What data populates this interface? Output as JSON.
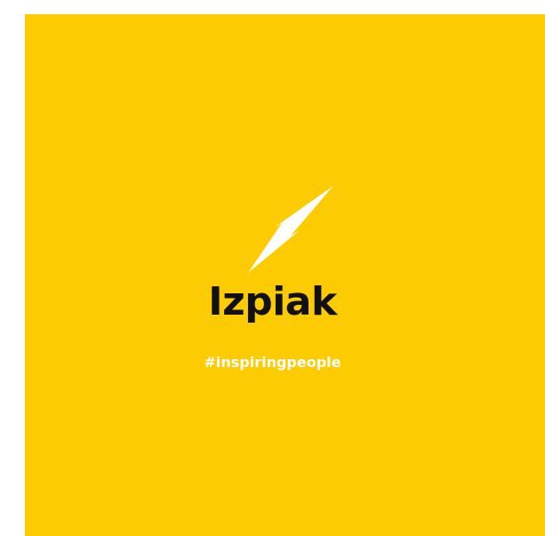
{
  "brand": {
    "name": "Izpiak",
    "tagline": "#inspiringpeople",
    "icon": "lightning-bolt-icon"
  },
  "colors": {
    "background": "#FDCB02",
    "page": "#FFFFFF",
    "brand_text": "#111111",
    "tagline_text": "#FFFFFF",
    "icon_fill": "#FFFFFF"
  }
}
